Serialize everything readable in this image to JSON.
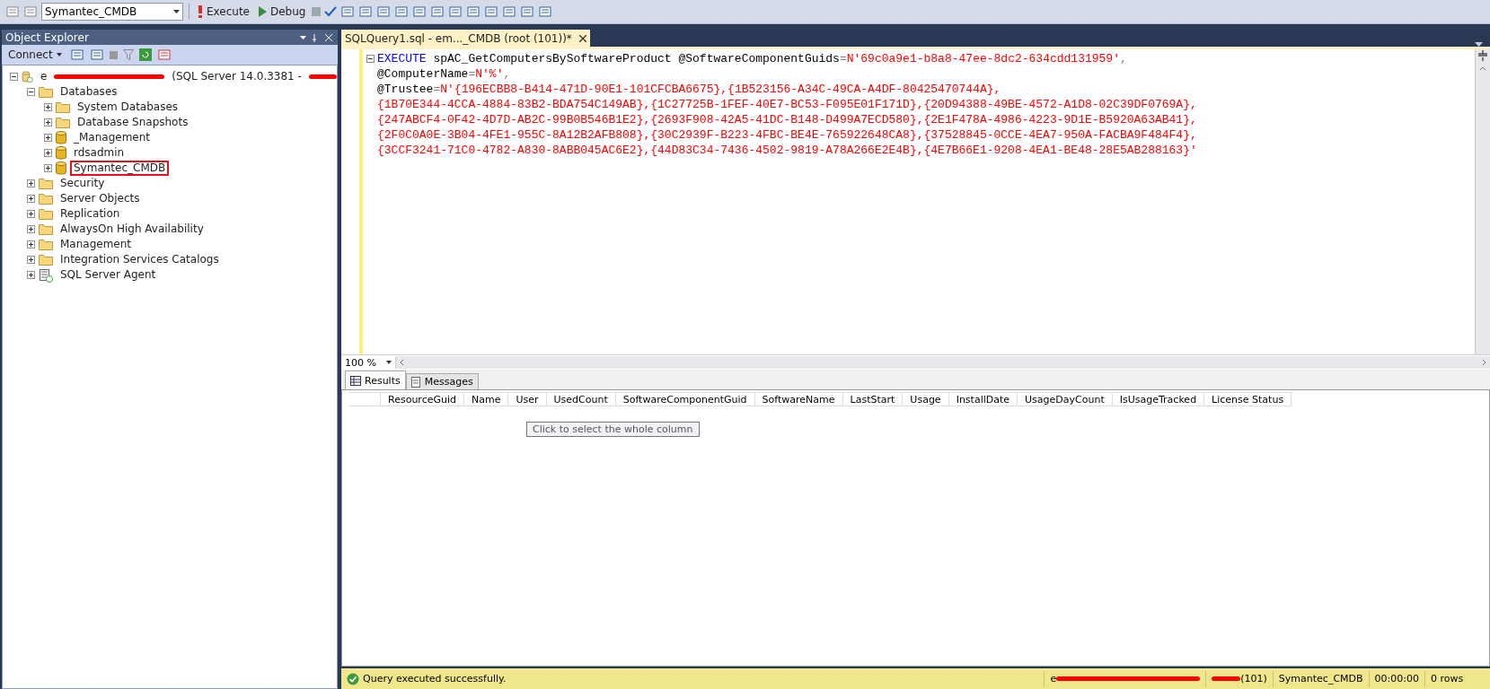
{
  "toolbar": {
    "database": "Symantec_CMDB",
    "buttons": [
      {
        "kind": "execute",
        "label": "Execute"
      },
      {
        "kind": "debug",
        "label": "Debug"
      }
    ]
  },
  "object_explorer": {
    "title": "Object Explorer",
    "connect": "Connect",
    "tree": [
      {
        "label": "e",
        "suffix": "(SQL Server 14.0.3381 -",
        "kind": "server",
        "expanded": true,
        "redacted": true,
        "selected": false,
        "children": [
          {
            "label": "Databases",
            "kind": "folder",
            "expanded": true,
            "selected": false,
            "children": [
              {
                "label": "System Databases",
                "kind": "folder",
                "expanded": false,
                "selected": false
              },
              {
                "label": "Database Snapshots",
                "kind": "folder",
                "expanded": false,
                "selected": false
              },
              {
                "label": "_Management",
                "kind": "database",
                "expanded": false,
                "selected": false
              },
              {
                "label": "rdsadmin",
                "kind": "database",
                "expanded": false,
                "selected": false
              },
              {
                "label": "Symantec_CMDB",
                "kind": "database",
                "expanded": false,
                "selected": true
              }
            ]
          },
          {
            "label": "Security",
            "kind": "folder",
            "expanded": false,
            "selected": false
          },
          {
            "label": "Server Objects",
            "kind": "folder",
            "expanded": false,
            "selected": false
          },
          {
            "label": "Replication",
            "kind": "folder",
            "expanded": false,
            "selected": false
          },
          {
            "label": "AlwaysOn High Availability",
            "kind": "folder",
            "expanded": false,
            "selected": false
          },
          {
            "label": "Management",
            "kind": "folder",
            "expanded": false,
            "selected": false
          },
          {
            "label": "Integration Services Catalogs",
            "kind": "folder",
            "expanded": false,
            "selected": false
          },
          {
            "label": "SQL Server Agent",
            "kind": "agent",
            "expanded": false,
            "selected": false
          }
        ]
      }
    ]
  },
  "editor": {
    "tab": "SQLQuery1.sql - em..._CMDB (root (101))*",
    "zoom": "100 %",
    "lines": [
      [
        {
          "kind": "keyword",
          "text": "EXECUTE"
        },
        {
          "kind": "plain",
          "text": " spAC_GetComputersBySoftwareProduct @SoftwareComponentGuids"
        },
        {
          "kind": "operator",
          "text": "="
        },
        {
          "kind": "string",
          "text": "N'69c0a9e1-b8a8-47ee-8dc2-634cdd131959'"
        },
        {
          "kind": "operator",
          "text": ","
        }
      ],
      [
        {
          "kind": "plain",
          "text": "@ComputerName"
        },
        {
          "kind": "operator",
          "text": "="
        },
        {
          "kind": "string",
          "text": "N'%'"
        },
        {
          "kind": "operator",
          "text": ","
        }
      ],
      [
        {
          "kind": "plain",
          "text": "@Trustee"
        },
        {
          "kind": "operator",
          "text": "="
        },
        {
          "kind": "string",
          "text": "N'{196ECBB8-B414-471D-90E1-101CFCBA6675},{1B523156-A34C-49CA-A4DF-80425470744A},"
        }
      ],
      [
        {
          "kind": "string",
          "text": "{1B70E344-4CCA-4884-83B2-BDA754C149AB},{1C27725B-1FEF-40E7-BC53-F095E01F171D},{20D94388-49BE-4572-A1D8-02C39DF0769A},"
        }
      ],
      [
        {
          "kind": "string",
          "text": "{247ABCF4-0F42-4D7D-AB2C-99B0B546B1E2},{2693F908-42A5-41DC-B148-D499A7ECD580},{2E1F478A-4986-4223-9D1E-B5920A63AB41},"
        }
      ],
      [
        {
          "kind": "string",
          "text": "{2F0C0A0E-3B04-4FE1-955C-8A12B2AFB808},{30C2939F-B223-4FBC-BE4E-765922648CA8},{37528845-0CCE-4EA7-950A-FACBA9F484F4},"
        }
      ],
      [
        {
          "kind": "string",
          "text": "{3CCF3241-71C0-4782-A830-8ABB045AC6E2},{44D83C34-7436-4502-9819-A78A266E2E4B},{4E7B66E1-9208-4EA1-BE48-28E5AB288163}'"
        }
      ]
    ]
  },
  "results": {
    "tabs": [
      {
        "label": "Results",
        "selected": true
      },
      {
        "label": "Messages",
        "selected": false
      }
    ],
    "columns": [
      "ResourceGuid",
      "Name",
      "User",
      "UsedCount",
      "SoftwareComponentGuid",
      "SoftwareName",
      "LastStart",
      "Usage",
      "InstallDate",
      "UsageDayCount",
      "IsUsageTracked",
      "License Status"
    ],
    "tooltip": "Click to select the whole column"
  },
  "status_bar": {
    "message": "Query executed successfully.",
    "server": "e",
    "user": "(101)",
    "database": "Symantec_CMDB",
    "time": "00:00:00",
    "rows": "0 rows"
  }
}
